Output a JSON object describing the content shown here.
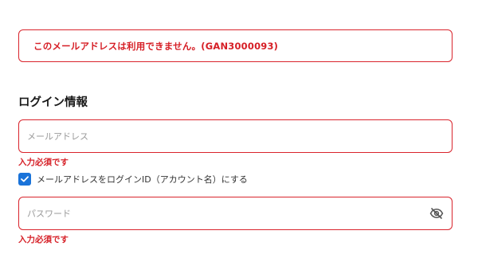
{
  "error_banner": {
    "message": "このメールアドレスは利用できません。(GAN3000093)"
  },
  "login_section": {
    "title": "ログイン情報",
    "email": {
      "value": "",
      "placeholder": "メールアドレス",
      "error": "入力必須です"
    },
    "use_email_as_id": {
      "checked": true,
      "label": "メールアドレスをログインID（アカウント名）にする"
    },
    "password": {
      "value": "",
      "placeholder": "パスワード",
      "error": "入力必須です",
      "visibility_icon": "eye-slash-icon"
    }
  },
  "colors": {
    "error": "#d61f26",
    "error_border": "#d9242c",
    "checkbox": "#1a73d9",
    "placeholder": "#9a9a9a"
  }
}
